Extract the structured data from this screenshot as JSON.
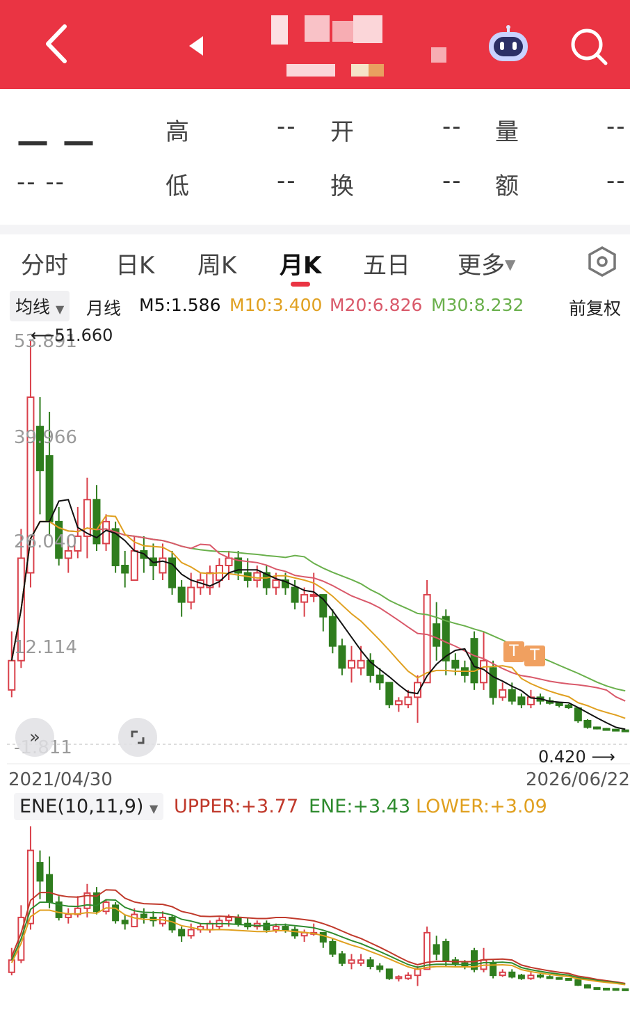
{
  "header": {
    "back_icon": "chevron-left-icon",
    "prev_icon": "triangle-left-icon",
    "robot_icon": "robot-assistant-icon",
    "search_icon": "search-icon",
    "color": "#ea3443"
  },
  "quote": {
    "price": "— —",
    "change": "-- --",
    "high_label": "高",
    "high_value": "--",
    "open_label": "开",
    "open_value": "--",
    "volume_label": "量",
    "volume_value": "--",
    "low_label": "低",
    "low_value": "--",
    "turnover_label": "换",
    "turnover_value": "--",
    "amount_label": "额",
    "amount_value": "--"
  },
  "tabs": [
    {
      "label": "分时"
    },
    {
      "label": "日K"
    },
    {
      "label": "周K"
    },
    {
      "label": "月K",
      "active": true
    },
    {
      "label": "五日"
    },
    {
      "label": "更多"
    }
  ],
  "ma_row": {
    "selector": "均线",
    "period": "月线",
    "m5": "M5:1.586",
    "m10": "M10:3.400",
    "m20": "M20:6.826",
    "m30": "M30:8.232",
    "adjust": "前复权",
    "colors": {
      "m5": "#111111",
      "m10": "#e0a020",
      "m20": "#d9596a",
      "m30": "#6ab04c"
    }
  },
  "main_chart": {
    "y_ticks": [
      "53.891",
      "39.966",
      "26.040",
      "12.114",
      "-1.811"
    ],
    "max_label": "51.660",
    "min_label": "0.420",
    "start_date": "2021/04/30",
    "end_date": "2026/06/22",
    "markers": [
      "T",
      "T"
    ]
  },
  "indicator": {
    "name": "ENE(10,11,9)",
    "upper": "UPPER:+3.77",
    "ene": "ENE:+3.43",
    "lower": "LOWER:+3.09",
    "colors": {
      "upper": "#c0392b",
      "ene": "#2e8b2e",
      "lower": "#e0a020"
    }
  },
  "chart_data": {
    "type": "candlestick",
    "title": "",
    "ylim": [
      -1.811,
      53.891
    ],
    "candles": [
      {
        "o": 6,
        "c": 10,
        "h": 14,
        "l": 5
      },
      {
        "o": 10,
        "c": 24,
        "h": 28,
        "l": 9
      },
      {
        "o": 22,
        "c": 46,
        "h": 53.9,
        "l": 20
      },
      {
        "o": 42,
        "c": 36,
        "h": 46,
        "l": 30
      },
      {
        "o": 38,
        "c": 29,
        "h": 44,
        "l": 27
      },
      {
        "o": 29,
        "c": 24,
        "h": 31,
        "l": 23
      },
      {
        "o": 24,
        "c": 25,
        "h": 27,
        "l": 22
      },
      {
        "o": 25,
        "c": 27,
        "h": 31,
        "l": 24
      },
      {
        "o": 27,
        "c": 32,
        "h": 35,
        "l": 24
      },
      {
        "o": 32,
        "c": 26,
        "h": 34,
        "l": 25
      },
      {
        "o": 26,
        "c": 29,
        "h": 30,
        "l": 25
      },
      {
        "o": 28,
        "c": 23,
        "h": 29,
        "l": 22
      },
      {
        "o": 23,
        "c": 22,
        "h": 25,
        "l": 20
      },
      {
        "o": 21,
        "c": 25,
        "h": 27,
        "l": 21
      },
      {
        "o": 25,
        "c": 24,
        "h": 27,
        "l": 22
      },
      {
        "o": 24,
        "c": 23,
        "h": 26,
        "l": 21
      },
      {
        "o": 22,
        "c": 24,
        "h": 26,
        "l": 21
      },
      {
        "o": 24,
        "c": 20,
        "h": 25,
        "l": 19
      },
      {
        "o": 20,
        "c": 18,
        "h": 21,
        "l": 16
      },
      {
        "o": 18,
        "c": 20,
        "h": 22,
        "l": 17
      },
      {
        "o": 20,
        "c": 21,
        "h": 22,
        "l": 19
      },
      {
        "o": 20,
        "c": 22,
        "h": 23,
        "l": 19
      },
      {
        "o": 21,
        "c": 23,
        "h": 24,
        "l": 20
      },
      {
        "o": 23,
        "c": 24,
        "h": 25,
        "l": 21
      },
      {
        "o": 24,
        "c": 22,
        "h": 25,
        "l": 21
      },
      {
        "o": 22,
        "c": 21,
        "h": 24,
        "l": 20
      },
      {
        "o": 21,
        "c": 22,
        "h": 23,
        "l": 20
      },
      {
        "o": 22,
        "c": 20,
        "h": 23,
        "l": 19
      },
      {
        "o": 20,
        "c": 21,
        "h": 22,
        "l": 19
      },
      {
        "o": 21,
        "c": 20,
        "h": 22,
        "l": 19
      },
      {
        "o": 20,
        "c": 18,
        "h": 21,
        "l": 17
      },
      {
        "o": 18,
        "c": 19,
        "h": 20,
        "l": 16
      },
      {
        "o": 19,
        "c": 19,
        "h": 22,
        "l": 18
      },
      {
        "o": 19,
        "c": 16,
        "h": 19,
        "l": 14
      },
      {
        "o": 16,
        "c": 12,
        "h": 17,
        "l": 11
      },
      {
        "o": 12,
        "c": 9,
        "h": 13,
        "l": 8
      },
      {
        "o": 9,
        "c": 10,
        "h": 12,
        "l": 7
      },
      {
        "o": 9,
        "c": 10,
        "h": 12,
        "l": 8
      },
      {
        "o": 10,
        "c": 8,
        "h": 11,
        "l": 7
      },
      {
        "o": 8,
        "c": 7,
        "h": 9,
        "l": 6
      },
      {
        "o": 7,
        "c": 4,
        "h": 7,
        "l": 3.5
      },
      {
        "o": 4,
        "c": 4.5,
        "h": 5,
        "l": 3
      },
      {
        "o": 4,
        "c": 5,
        "h": 6,
        "l": 3.5
      },
      {
        "o": 5,
        "c": 7,
        "h": 8,
        "l": 1.5
      },
      {
        "o": 7,
        "c": 19,
        "h": 21,
        "l": 7
      },
      {
        "o": 15,
        "c": 12,
        "h": 18,
        "l": 10
      },
      {
        "o": 16,
        "c": 10,
        "h": 17,
        "l": 8
      },
      {
        "o": 10,
        "c": 9,
        "h": 11,
        "l": 8
      },
      {
        "o": 9,
        "c": 8,
        "h": 10,
        "l": 7
      },
      {
        "o": 13,
        "c": 7,
        "h": 14,
        "l": 6
      },
      {
        "o": 7,
        "c": 10,
        "h": 14,
        "l": 6
      },
      {
        "o": 9,
        "c": 5,
        "h": 10,
        "l": 4
      },
      {
        "o": 5,
        "c": 6,
        "h": 7,
        "l": 4.5
      },
      {
        "o": 6,
        "c": 4.5,
        "h": 7,
        "l": 4
      },
      {
        "o": 5,
        "c": 4,
        "h": 5.5,
        "l": 3.5
      },
      {
        "o": 4,
        "c": 5,
        "h": 6,
        "l": 3.5
      },
      {
        "o": 5,
        "c": 4.5,
        "h": 5.5,
        "l": 4
      },
      {
        "o": 4.5,
        "c": 4.2,
        "h": 5,
        "l": 4
      },
      {
        "o": 4.2,
        "c": 3.9,
        "h": 4.4,
        "l": 3.6
      },
      {
        "o": 3.9,
        "c": 3.6,
        "h": 4.1,
        "l": 3.4
      },
      {
        "o": 3.5,
        "c": 1.8,
        "h": 3.6,
        "l": 1.5
      },
      {
        "o": 1.8,
        "c": 0.9,
        "h": 2,
        "l": 0.7
      },
      {
        "o": 0.9,
        "c": 0.7,
        "h": 1,
        "l": 0.6
      },
      {
        "o": 0.7,
        "c": 0.6,
        "h": 0.8,
        "l": 0.5
      },
      {
        "o": 0.6,
        "c": 0.5,
        "h": 0.65,
        "l": 0.45
      },
      {
        "o": 0.5,
        "c": 0.42,
        "h": 0.55,
        "l": 0.42
      }
    ]
  }
}
